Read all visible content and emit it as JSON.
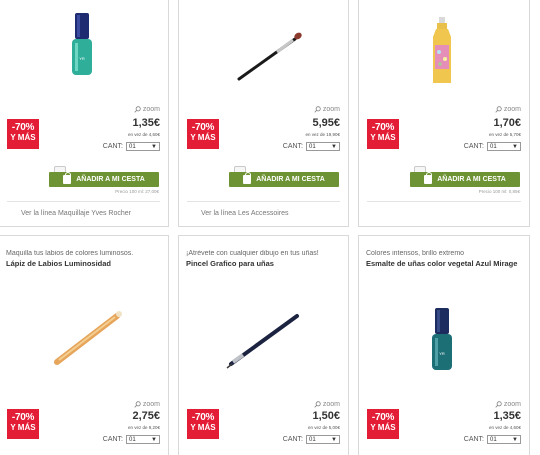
{
  "top_row": [
    {
      "discount": {
        "pct": "-70%",
        "mas": "Y MÁS"
      },
      "zoom": "zoom",
      "price": "1,35€",
      "old_price": "en vez de 4,60€",
      "cant_label": "CANT:",
      "qty": "01",
      "add_label": "AÑADIR A MI CESTA",
      "unit_price": "Precio 100 ml: 27,00€",
      "line_link": "Ver la línea Maquillaje Yves Rocher",
      "image": "nail-polish-green"
    },
    {
      "discount": {
        "pct": "-70%",
        "mas": "Y MÁS"
      },
      "zoom": "zoom",
      "price": "5,95€",
      "old_price": "en vez de 19,90€",
      "cant_label": "CANT:",
      "qty": "01",
      "add_label": "AÑADIR A MI CESTA",
      "unit_price": "",
      "line_link": "Ver la línea Les Accessoires",
      "image": "makeup-brush"
    },
    {
      "discount": {
        "pct": "-70%",
        "mas": "Y MÁS"
      },
      "zoom": "zoom",
      "price": "1,70€",
      "old_price": "en vez de 5,70€",
      "cant_label": "CANT:",
      "qty": "01",
      "add_label": "AÑADIR A MI CESTA",
      "unit_price": "Precio 100 ml: 0,85€",
      "line_link": "",
      "image": "shower-gel-bottle"
    }
  ],
  "bottom_row": [
    {
      "subtitle": "Maquilla tus labios de colores luminosos.",
      "name": "Lápiz de Labios Luminosidad",
      "discount": {
        "pct": "-70%",
        "mas": "Y MÁS"
      },
      "zoom": "zoom",
      "price": "2,75€",
      "old_price": "en vez de 9,20€",
      "cant_label": "CANT:",
      "qty": "01",
      "image": "lip-pencil-gold"
    },
    {
      "subtitle": "¡Atrévete con cualquier dibujo en tus uñas!",
      "name": "Pincel Grafico para uñas",
      "discount": {
        "pct": "-70%",
        "mas": "Y MÁS"
      },
      "zoom": "zoom",
      "price": "1,50€",
      "old_price": "en vez de 5,00€",
      "cant_label": "CANT:",
      "qty": "01",
      "image": "nail-art-brush"
    },
    {
      "subtitle": "Colores intensos, brillo extremo",
      "name": "Esmalte de uñas color vegetal Azul Mirage",
      "discount": {
        "pct": "-70%",
        "mas": "Y MÁS"
      },
      "zoom": "zoom",
      "price": "1,35€",
      "old_price": "en vez de 4,60€",
      "cant_label": "CANT:",
      "qty": "01",
      "image": "nail-polish-teal"
    }
  ],
  "colors": {
    "badge": "#e41d37",
    "cart_button": "#6e9334",
    "border": "#d9d9d9"
  }
}
